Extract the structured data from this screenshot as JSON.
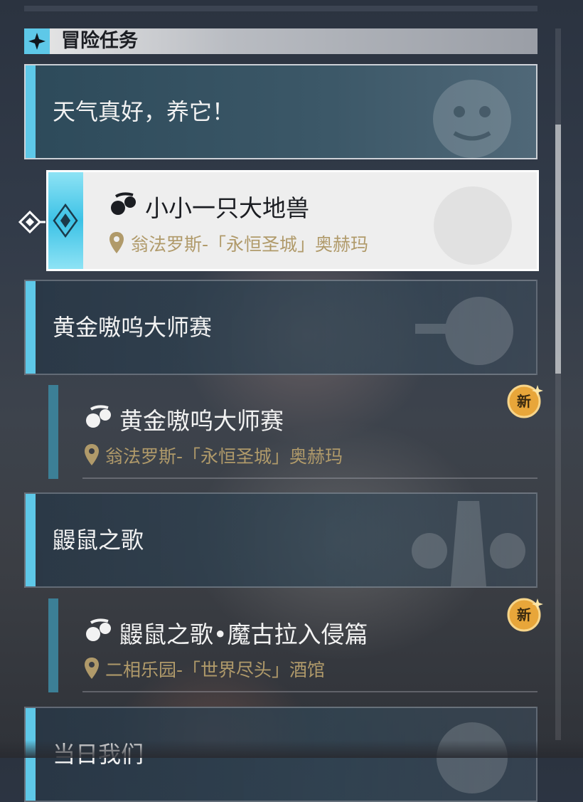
{
  "header": {
    "title": "冒险任务",
    "icon": "sparkle-icon"
  },
  "groups": [
    {
      "title": "天气真好，养它！"
    },
    {
      "title": "黄金嗷呜大师赛"
    },
    {
      "title": "鼹鼠之歌"
    },
    {
      "title": "当日我们"
    }
  ],
  "quests": [
    {
      "title": "小小一只大地兽",
      "location": "翁法罗斯-「永恒圣城」奥赫玛",
      "selected": true
    },
    {
      "title": "黄金嗷呜大师赛",
      "location": "翁法罗斯-「永恒圣城」奥赫玛",
      "badge": "新"
    },
    {
      "title": "鼹鼠之歌•魔古拉入侵篇",
      "location": "二相乐园-「世界尽头」酒馆",
      "badge": "新"
    }
  ],
  "colors": {
    "accent": "#5ec8e8",
    "location": "#b09a6a",
    "badge": "#e8a63a"
  }
}
